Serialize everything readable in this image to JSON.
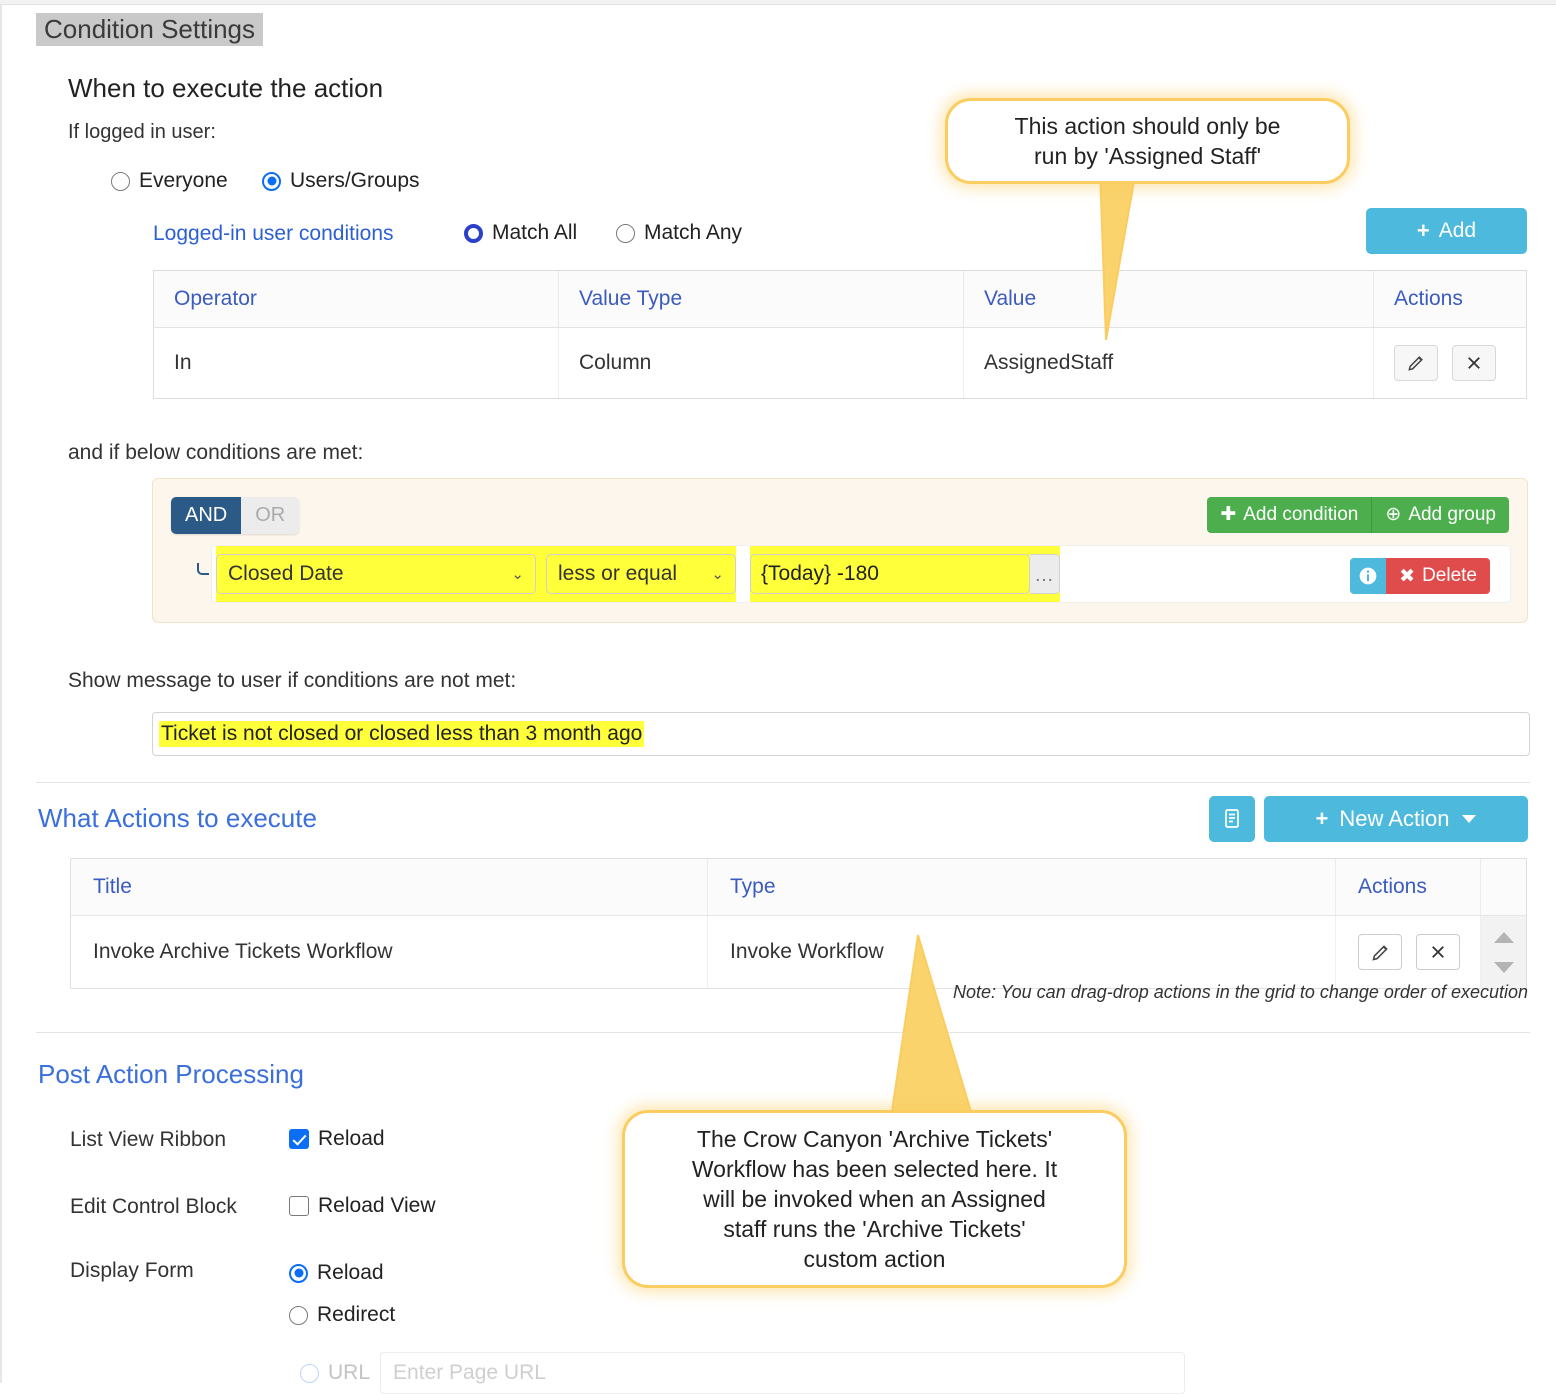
{
  "page": {
    "section_title": "Condition Settings",
    "when_title": "When to execute the action",
    "if_logged_label": "If logged in user:"
  },
  "user_scope": {
    "options": [
      {
        "label": "Everyone",
        "selected": false
      },
      {
        "label": "Users/Groups",
        "selected": true
      }
    ]
  },
  "logged_in_conditions": {
    "link_label": "Logged-in user conditions",
    "match_options": [
      {
        "label": "Match All",
        "selected": true
      },
      {
        "label": "Match Any",
        "selected": false
      }
    ],
    "add_button": "Add",
    "add_icon": "plus-icon",
    "table": {
      "columns": [
        "Operator",
        "Value Type",
        "Value",
        "Actions"
      ],
      "rows": [
        {
          "operator": "In",
          "value_type": "Column",
          "value": "AssignedStaff",
          "actions": [
            "edit-pencil-icon",
            "delete-x-icon"
          ]
        }
      ]
    }
  },
  "conditions_block": {
    "label": "and if below conditions are met:",
    "logic": {
      "and_label": "AND",
      "or_label": "OR",
      "selected": "AND"
    },
    "add_condition_label": "Add condition",
    "add_group_label": "Add group",
    "add_condition_icon": "plus-icon",
    "add_group_icon": "plus-circle-icon",
    "rule": {
      "field": "Closed Date",
      "operator": "less or equal",
      "value": "{Today} -180",
      "browse_label": "...",
      "info_icon": "info-icon",
      "delete_label": "Delete",
      "delete_icon": "x-icon"
    }
  },
  "message": {
    "label": "Show message to user if conditions are not met:",
    "value": "Ticket is not closed or closed less than 3 month ago"
  },
  "actions_section": {
    "title": "What Actions to execute",
    "doc_button_icon": "document-list-icon",
    "new_action_label": "New Action",
    "new_action_icon": "plus-icon",
    "new_action_caret": "chevron-down-icon",
    "table": {
      "columns": [
        "Title",
        "Type",
        "Actions"
      ],
      "rows": [
        {
          "title": "Invoke Archive Tickets Workflow",
          "type": "Invoke Workflow",
          "actions": [
            "edit-pencil-icon",
            "delete-x-icon"
          ]
        }
      ]
    },
    "note": "Note: You can drag-drop actions in the grid to change order of execution"
  },
  "post_action": {
    "title": "Post Action Processing",
    "rows": [
      {
        "label": "List View Ribbon",
        "control": "checkbox",
        "option": "Reload",
        "checked": true
      },
      {
        "label": "Edit Control Block",
        "control": "checkbox",
        "option": "Reload View",
        "checked": false
      },
      {
        "label": "Display Form",
        "control": "radio",
        "option": "Reload",
        "checked": true
      },
      {
        "label": "",
        "control": "radio",
        "option": "Redirect",
        "checked": false
      }
    ],
    "url_row": {
      "label": "URL",
      "placeholder": "Enter Page URL",
      "value": ""
    }
  },
  "callouts": [
    {
      "text": "This action should only be\nrun by 'Assigned Staff'"
    },
    {
      "text": "The Crow Canyon 'Archive Tickets'\nWorkflow has been selected here. It\nwill be invoked when an Assigned\nstaff runs the 'Archive Tickets'\ncustom action"
    }
  ],
  "colors": {
    "accent_blue": "#4cb9dd",
    "link_blue": "#3b6fdc",
    "header_blue": "#3b5bbf",
    "green": "#4cae4c",
    "red": "#e04b4b",
    "highlight_yellow": "#ffff3a",
    "callout_border": "#fbcc5f",
    "and_navy": "#2b5a86"
  }
}
